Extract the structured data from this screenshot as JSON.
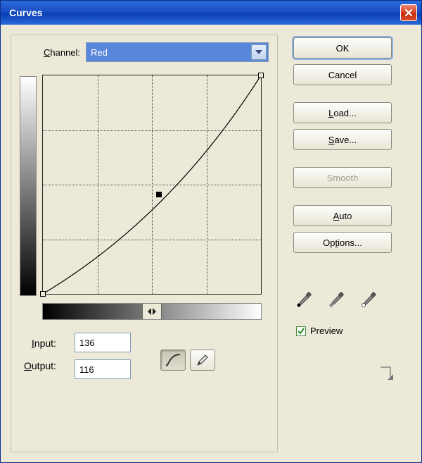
{
  "titlebar": {
    "title": "Curves"
  },
  "channel": {
    "label_prefix": "C",
    "label_rest": "hannel:",
    "value": "Red"
  },
  "io": {
    "input_label_pre": "I",
    "input_label_rest": "nput:",
    "output_label_pre": "O",
    "output_label_rest": "utput:",
    "input_value": "136",
    "output_value": "116"
  },
  "buttons": {
    "ok": "OK",
    "cancel": "Cancel",
    "load_pre": "L",
    "load_rest": "oad...",
    "save_pre": "S",
    "save_rest": "ave...",
    "smooth_pre": "S",
    "smooth_rest": "mooth",
    "auto_pre": "A",
    "auto_rest": "uto",
    "options_pre": "Op",
    "options_u": "t",
    "options_rest": "ions..."
  },
  "preview": {
    "checked": true,
    "label_u": "P",
    "label_rest": "review"
  },
  "chart_data": {
    "type": "curve",
    "xlim": [
      0,
      255
    ],
    "ylim": [
      0,
      255
    ],
    "grid_divisions": 4,
    "endpoints": [
      [
        0,
        0
      ],
      [
        255,
        255
      ]
    ],
    "control_point": {
      "input": 136,
      "output": 116
    },
    "curve_points": [
      [
        0,
        0
      ],
      [
        68,
        52
      ],
      [
        136,
        116
      ],
      [
        200,
        192
      ],
      [
        255,
        255
      ]
    ]
  }
}
